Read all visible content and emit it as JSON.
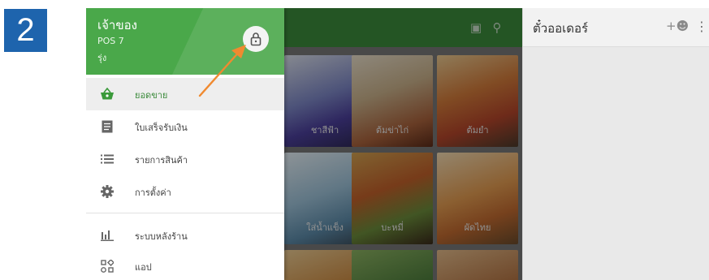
{
  "step_number": "2",
  "drawer": {
    "owner_name": "เจ้าของ",
    "pos_name": "POS 7",
    "sub_name": "รุ่ง",
    "menu": [
      {
        "label": "ยอดขาย",
        "icon": "basket-icon"
      },
      {
        "label": "ใบเสร็จรับเงิน",
        "icon": "receipt-icon"
      },
      {
        "label": "รายการสินค้า",
        "icon": "list-icon"
      },
      {
        "label": "การตั้งค่า",
        "icon": "gear-icon"
      },
      {
        "label": "ระบบหลังร้าน",
        "icon": "bar-chart-icon"
      },
      {
        "label": "แอป",
        "icon": "apps-icon"
      }
    ]
  },
  "products": [
    "ชาสีฟ้า",
    "ต้มข่าไก่",
    "ต้มยำ",
    "ใส่น้ำแข็ง",
    "บะหมี่",
    "ผัดไทย"
  ],
  "order_panel": {
    "title": "ตั๋วออเดอร์"
  },
  "colors": {
    "brand_green": "#4aa84a",
    "step_badge_blue": "#1e64ad",
    "arrow_orange": "#f08a30"
  }
}
